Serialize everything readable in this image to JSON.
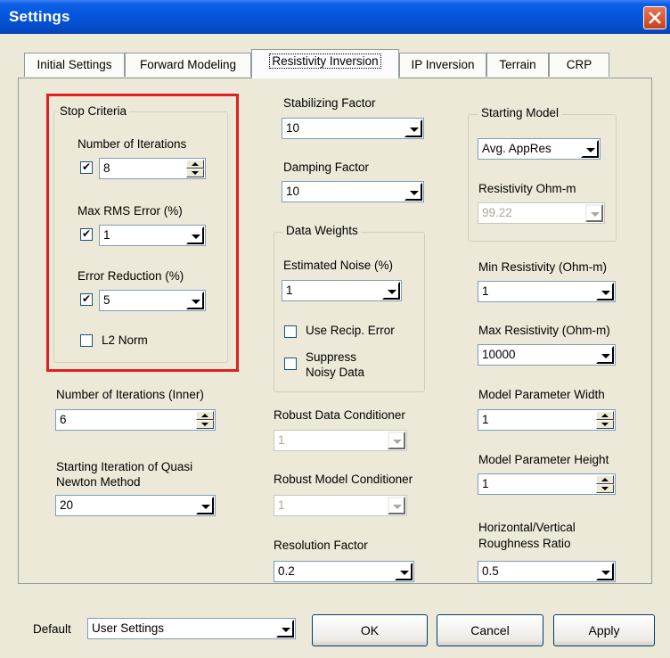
{
  "window": {
    "title": "Settings"
  },
  "tabs": [
    {
      "label": "Initial Settings"
    },
    {
      "label": "Forward Modeling"
    },
    {
      "label": "Resistivity Inversion"
    },
    {
      "label": "IP Inversion"
    },
    {
      "label": "Terrain"
    },
    {
      "label": "CRP"
    }
  ],
  "active_tab": "Resistivity Inversion",
  "stop_criteria": {
    "title": "Stop Criteria",
    "iterations_label": "Number of Iterations",
    "iterations_checked": true,
    "iterations_value": "8",
    "rms_label": "Max RMS Error (%)",
    "rms_checked": true,
    "rms_value": "1",
    "reduction_label": "Error Reduction (%)",
    "reduction_checked": true,
    "reduction_value": "5",
    "l2_label": "L2 Norm",
    "l2_checked": false
  },
  "inner_iterations": {
    "label": "Number of Iterations (Inner)",
    "value": "6"
  },
  "quasi_newton": {
    "label_line1": "Starting Iteration of Quasi",
    "label_line2": "Newton Method",
    "value": "20"
  },
  "stabilizing_factor": {
    "label": "Stabilizing Factor",
    "value": "10"
  },
  "damping_factor": {
    "label": "Damping Factor",
    "value": "10"
  },
  "data_weights": {
    "title": "Data Weights",
    "noise_label": "Estimated Noise (%)",
    "noise_value": "1",
    "recip_label": "Use Recip. Error",
    "recip_checked": false,
    "suppress_label_line1": "Suppress",
    "suppress_label_line2": "Noisy Data",
    "suppress_checked": false
  },
  "robust_data": {
    "label": "Robust Data Conditioner",
    "value": "1"
  },
  "robust_model": {
    "label": "Robust Model Conditioner",
    "value": "1"
  },
  "resolution_factor": {
    "label": "Resolution Factor",
    "value": "0.2"
  },
  "starting_model": {
    "title": "Starting Model",
    "type_value": "Avg. AppRes",
    "resistivity_label": "Resistivity Ohm-m",
    "resistivity_value": "99.22"
  },
  "min_resistivity": {
    "label": "Min Resistivity (Ohm-m)",
    "value": "1"
  },
  "max_resistivity": {
    "label": "Max Resistivity (Ohm-m)",
    "value": "10000"
  },
  "param_width": {
    "label": "Model Parameter Width",
    "value": "1"
  },
  "param_height": {
    "label": "Model Parameter Height",
    "value": "1"
  },
  "roughness": {
    "label_line1": "Horizontal/Vertical",
    "label_line2": "Roughness Ratio",
    "value": "0.5"
  },
  "footer": {
    "default_label": "Default",
    "default_value": "User Settings",
    "ok_label": "OK",
    "cancel_label": "Cancel",
    "apply_label": "Apply"
  }
}
